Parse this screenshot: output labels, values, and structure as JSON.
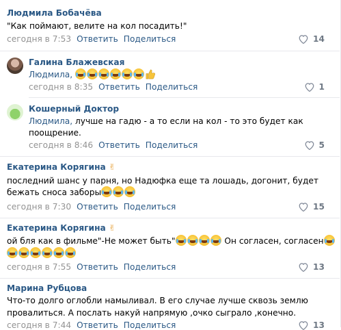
{
  "actions": {
    "reply": "Ответить",
    "share": "Поделиться"
  },
  "comments": [
    {
      "author": "Людмила Бобачёва",
      "text": "\"Как поймают, велите на кол посадить!\"",
      "time": "сегодня в 7:53",
      "likes": "14"
    },
    {
      "author": "Галина Блажевская",
      "reply_to": "Людмила,",
      "text": "",
      "emoji_count": 6,
      "time": "сегодня в 8:35",
      "likes": "1"
    },
    {
      "author": "Кошерный Доктор",
      "reply_to": "Людмила,",
      "text_line1": " лучше на гадю - а то если на кол - то это будет как",
      "text_line2": "поощрение.",
      "time": "сегодня в 8:46",
      "likes": "5"
    },
    {
      "author": "Екатерина Корягина",
      "author_emoji": "✌",
      "text_line1": "последний шанс у парня, но Надюфка еще та лошадь, догонит, будет",
      "text_line2": "бежать сноса заборы",
      "time": "сегодня в 7:30",
      "likes": "15"
    },
    {
      "author": "Екатерина Корягина",
      "author_emoji": "✌",
      "text_line1a": "ой бля как в фильме\"-Не может быть\"",
      "text_line1b": " Он согласен, согласен",
      "time": "сегодня в 7:55",
      "likes": "13"
    },
    {
      "author": "Марина Рубцова",
      "text_line1": "Что-то долго оглобли намыливал. В его случае лучше сквозь землю",
      "text_line2": "провалиться. А послать накуй напрямую ,очко сыграло ,конечно.",
      "time": "сегодня в 7:44",
      "likes": "13"
    }
  ]
}
